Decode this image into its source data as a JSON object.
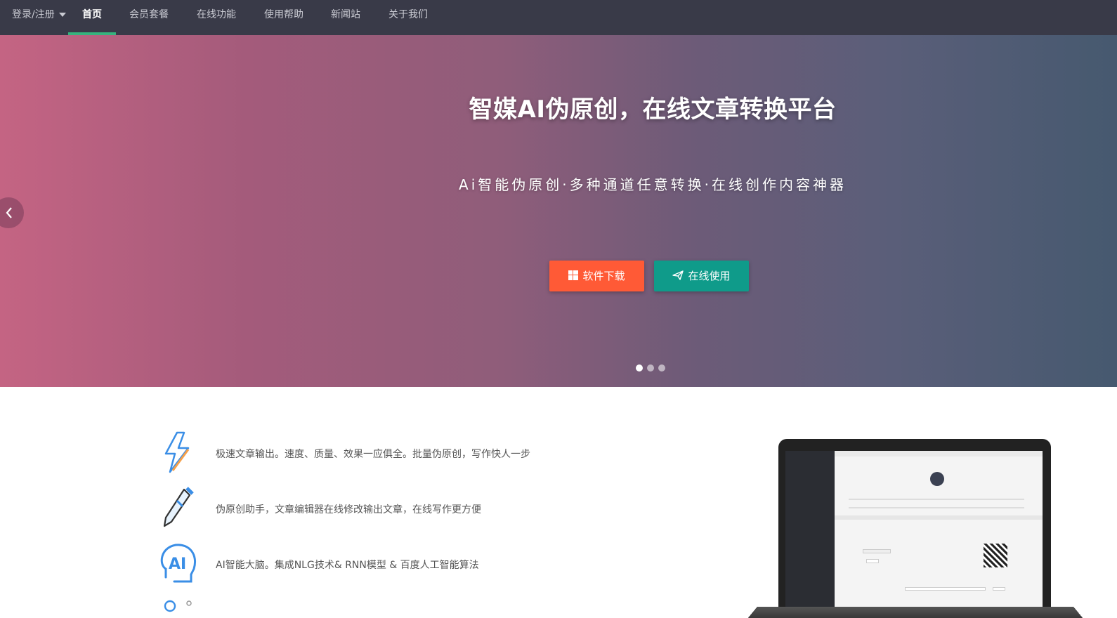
{
  "nav": {
    "login": "登录/注册",
    "items": [
      "首页",
      "会员套餐",
      "在线功能",
      "使用帮助",
      "新闻站",
      "关于我们"
    ],
    "active_index": 0,
    "accent_color": "#36b37e"
  },
  "hero": {
    "title": "智媒AI伪原创，在线文章转换平台",
    "subtitle": "Ai智能伪原创·多种通道任意转换·在线创作内容神器",
    "buttons": {
      "download": "软件下载",
      "online": "在线使用"
    },
    "slides_total": 3,
    "active_slide": 0,
    "download_color": "#ff5a36",
    "online_color": "#0f9b8a"
  },
  "features": [
    {
      "icon": "lightning-icon",
      "text": "极速文章输出。速度、质量、效果一应俱全。批量伪原创，写作快人一步"
    },
    {
      "icon": "pen-icon",
      "text": "伪原创助手，文章编辑器在线修改输出文章，在线写作更方便"
    },
    {
      "icon": "ai-brain-icon",
      "text": "AI智能大脑。集成NLG技术& RNN模型 & 百度人工智能算法"
    }
  ]
}
